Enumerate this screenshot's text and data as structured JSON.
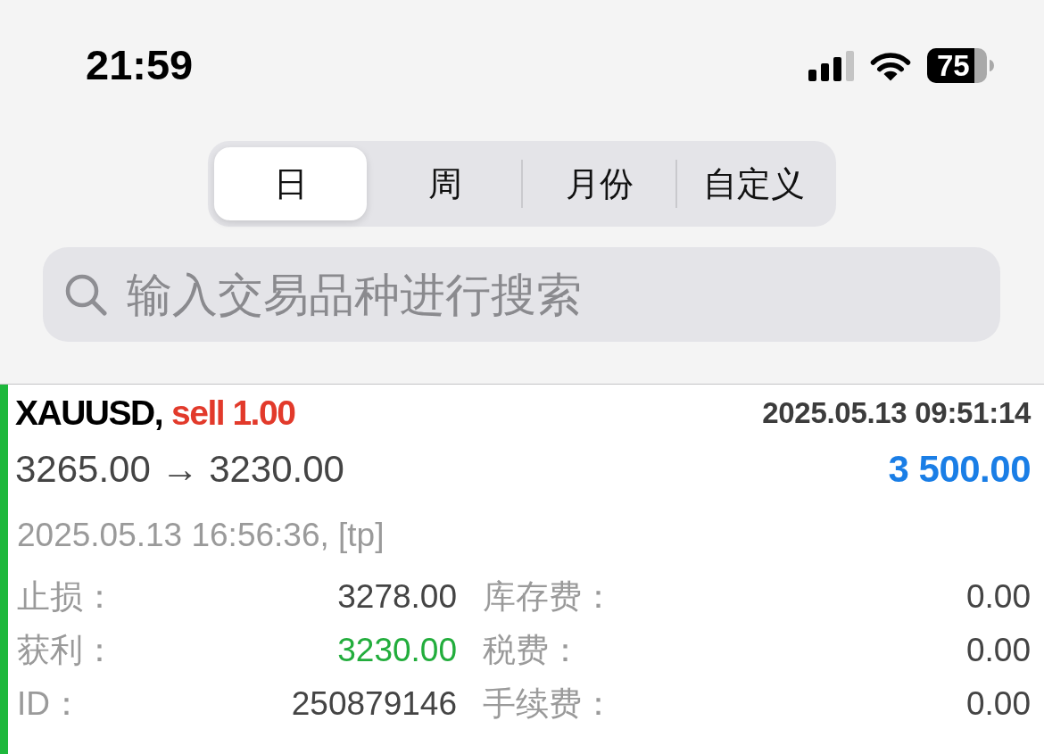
{
  "status_bar": {
    "time": "21:59",
    "battery": "75"
  },
  "period_tabs": [
    {
      "label": "日",
      "selected": true
    },
    {
      "label": "周",
      "selected": false
    },
    {
      "label": "月份",
      "selected": false
    },
    {
      "label": "自定义",
      "selected": false
    }
  ],
  "search": {
    "placeholder": "输入交易品种进行搜索"
  },
  "trade": {
    "symbol": "XAUUSD,",
    "order": "sell 1.00",
    "open_time": "2025.05.13 09:51:14",
    "prices": "3265.00 → 3230.00",
    "profit": "3 500.00",
    "close_info": "2025.05.13 16:56:36, [tp]",
    "details": [
      {
        "label": "止损：",
        "value": "3278.00",
        "color": "#444444"
      },
      {
        "label": "库存费：",
        "value": "0.00",
        "color": "#444444"
      },
      {
        "label": "获利：",
        "value": "3230.00",
        "color": "#22ad3c"
      },
      {
        "label": "税费：",
        "value": "0.00",
        "color": "#444444"
      },
      {
        "label": "ID：",
        "value": "250879146",
        "color": "#444444"
      },
      {
        "label": "手续费：",
        "value": "0.00",
        "color": "#444444"
      }
    ]
  }
}
